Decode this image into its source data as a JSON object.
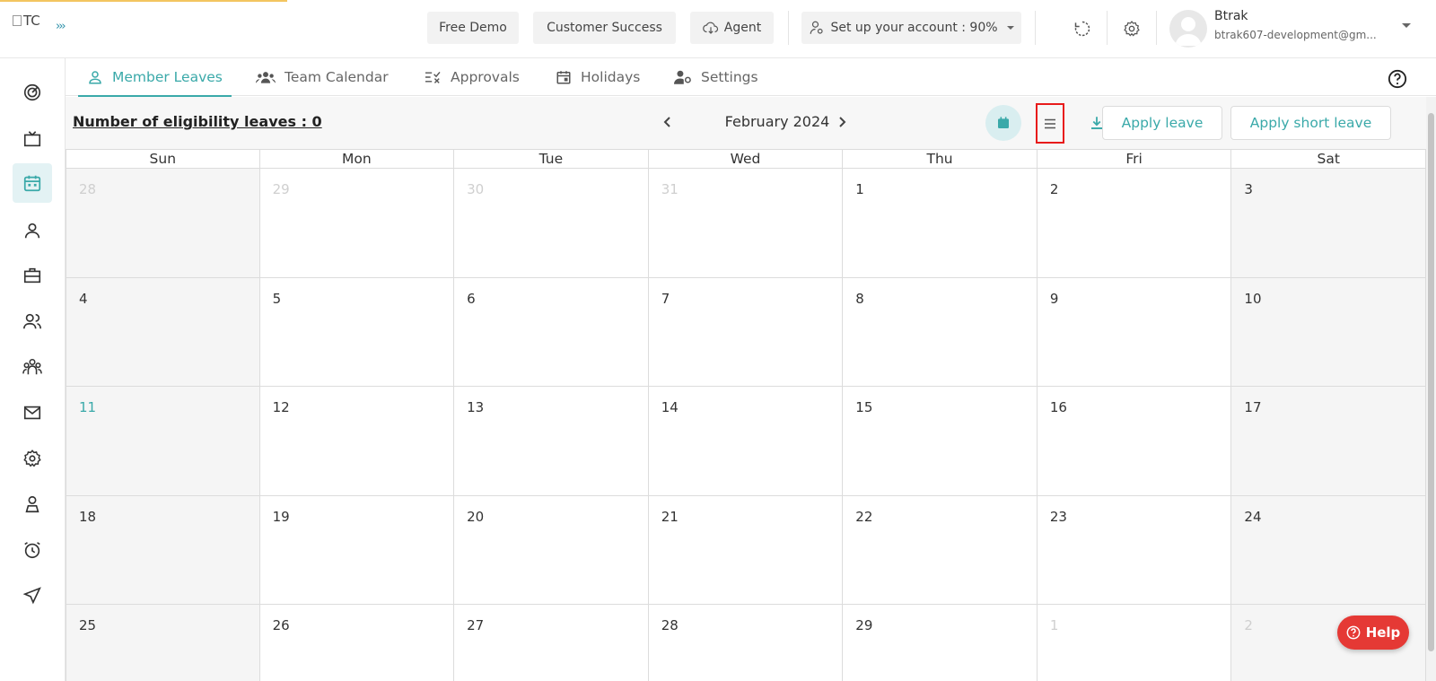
{
  "header": {
    "logo_text": "TC",
    "buttons": {
      "free_demo": "Free Demo",
      "customer_success": "Customer Success",
      "agent": "Agent",
      "setup_account": "Set up your account : 90%"
    },
    "user": {
      "name": "Btrak",
      "email": "btrak607-development@gm..."
    }
  },
  "tabs": [
    {
      "label": "Member Leaves",
      "active": true,
      "icon": "person-icon"
    },
    {
      "label": "Team Calendar",
      "active": false,
      "icon": "group-icon"
    },
    {
      "label": "Approvals",
      "active": false,
      "icon": "approvals-icon"
    },
    {
      "label": "Holidays",
      "active": false,
      "icon": "calendar-icon"
    },
    {
      "label": "Settings",
      "active": false,
      "icon": "user-settings-icon"
    }
  ],
  "toolbar": {
    "eligibility": "Number of eligibility leaves : 0",
    "month": "February 2024",
    "apply_leave": "Apply leave",
    "apply_short_leave": "Apply short leave"
  },
  "calendar": {
    "days_of_week": [
      "Sun",
      "Mon",
      "Tue",
      "Wed",
      "Thu",
      "Fri",
      "Sat"
    ],
    "weeks": [
      [
        "28",
        "29",
        "30",
        "31",
        "1",
        "2",
        "3"
      ],
      [
        "4",
        "5",
        "6",
        "7",
        "8",
        "9",
        "10"
      ],
      [
        "11",
        "12",
        "13",
        "14",
        "15",
        "16",
        "17"
      ],
      [
        "18",
        "19",
        "20",
        "21",
        "22",
        "23",
        "24"
      ],
      [
        "25",
        "26",
        "27",
        "28",
        "29",
        "1",
        "2"
      ]
    ]
  },
  "help_button": "Help",
  "colors": {
    "accent": "#3aa9a9",
    "highlight": "#e81b1b",
    "help": "#e53935"
  }
}
